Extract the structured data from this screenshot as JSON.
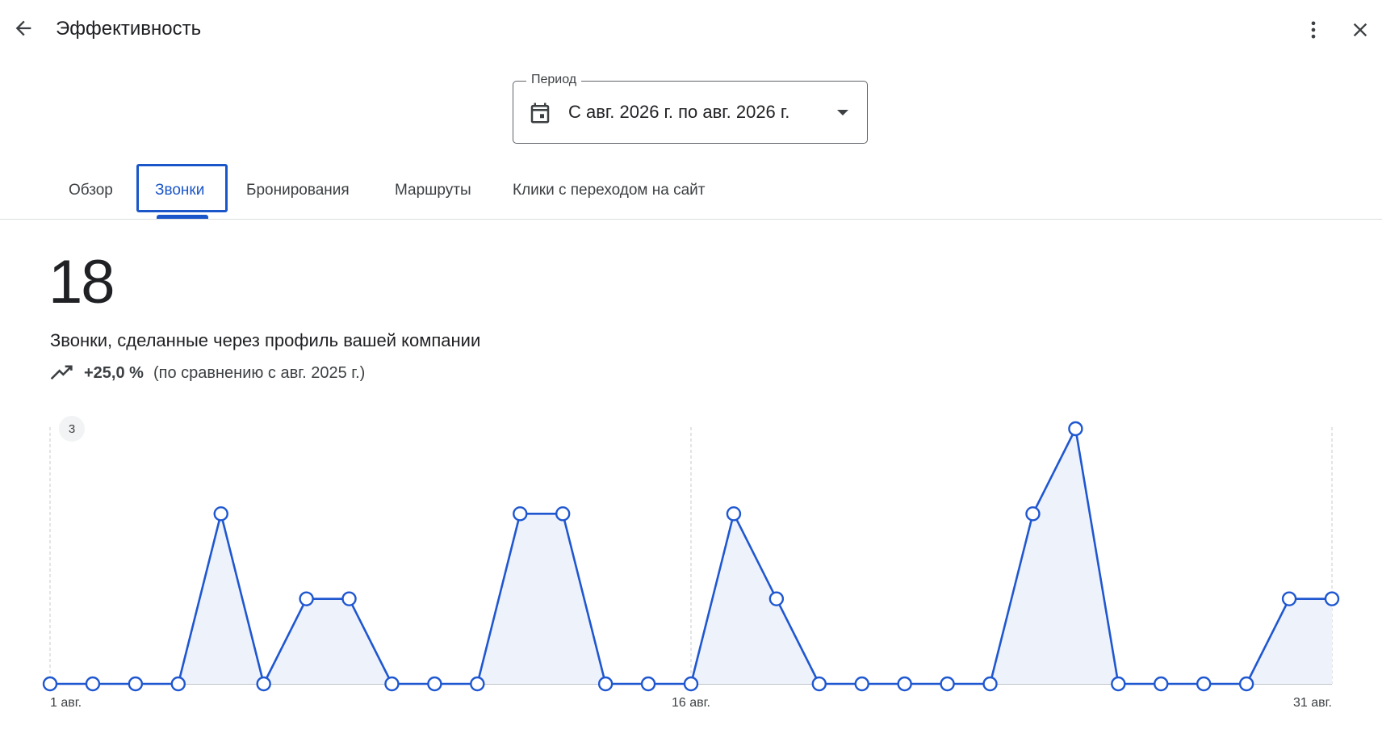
{
  "header": {
    "title": "Эффективность",
    "back_icon": "arrow-left-icon",
    "more_icon": "more-vertical-icon",
    "close_icon": "close-icon"
  },
  "period": {
    "label": "Период",
    "value": "С авг. 2026 г. по авг. 2026 г.",
    "icon": "calendar-icon"
  },
  "tabs": [
    {
      "label": "Обзор",
      "active": false
    },
    {
      "label": "Звонки",
      "active": true
    },
    {
      "label": "Бронирования",
      "active": false
    },
    {
      "label": "Маршруты",
      "active": false
    },
    {
      "label": "Клики с переходом на сайт",
      "active": false
    }
  ],
  "metric": {
    "value": "18",
    "description": "Звонки, сделанные через профиль вашей компании",
    "change": "+25,0 %",
    "comparison": "(по сравнению с авг. 2025 г.)",
    "trend_icon": "trending-up-icon"
  },
  "colors": {
    "accent": "#1a56c9",
    "line": "#1f57d0",
    "fill": "#eef2fb"
  },
  "chart_data": {
    "type": "area",
    "x": [
      1,
      2,
      3,
      4,
      5,
      6,
      7,
      8,
      9,
      10,
      11,
      12,
      13,
      14,
      15,
      16,
      17,
      18,
      19,
      20,
      21,
      22,
      23,
      24,
      25,
      26,
      27,
      28,
      29,
      30,
      31
    ],
    "values": [
      0,
      0,
      0,
      0,
      2,
      0,
      1,
      1,
      0,
      0,
      0,
      2,
      2,
      0,
      0,
      0,
      2,
      1,
      0,
      0,
      0,
      0,
      0,
      2,
      3,
      0,
      0,
      0,
      0,
      1,
      1
    ],
    "x_tick_labels": [
      {
        "x": 1,
        "label": "1 авг."
      },
      {
        "x": 16,
        "label": "16 авг."
      },
      {
        "x": 31,
        "label": "31 авг."
      }
    ],
    "y_max_label": "3",
    "ylim": [
      0,
      3
    ],
    "grid": "vertical-dashed"
  }
}
